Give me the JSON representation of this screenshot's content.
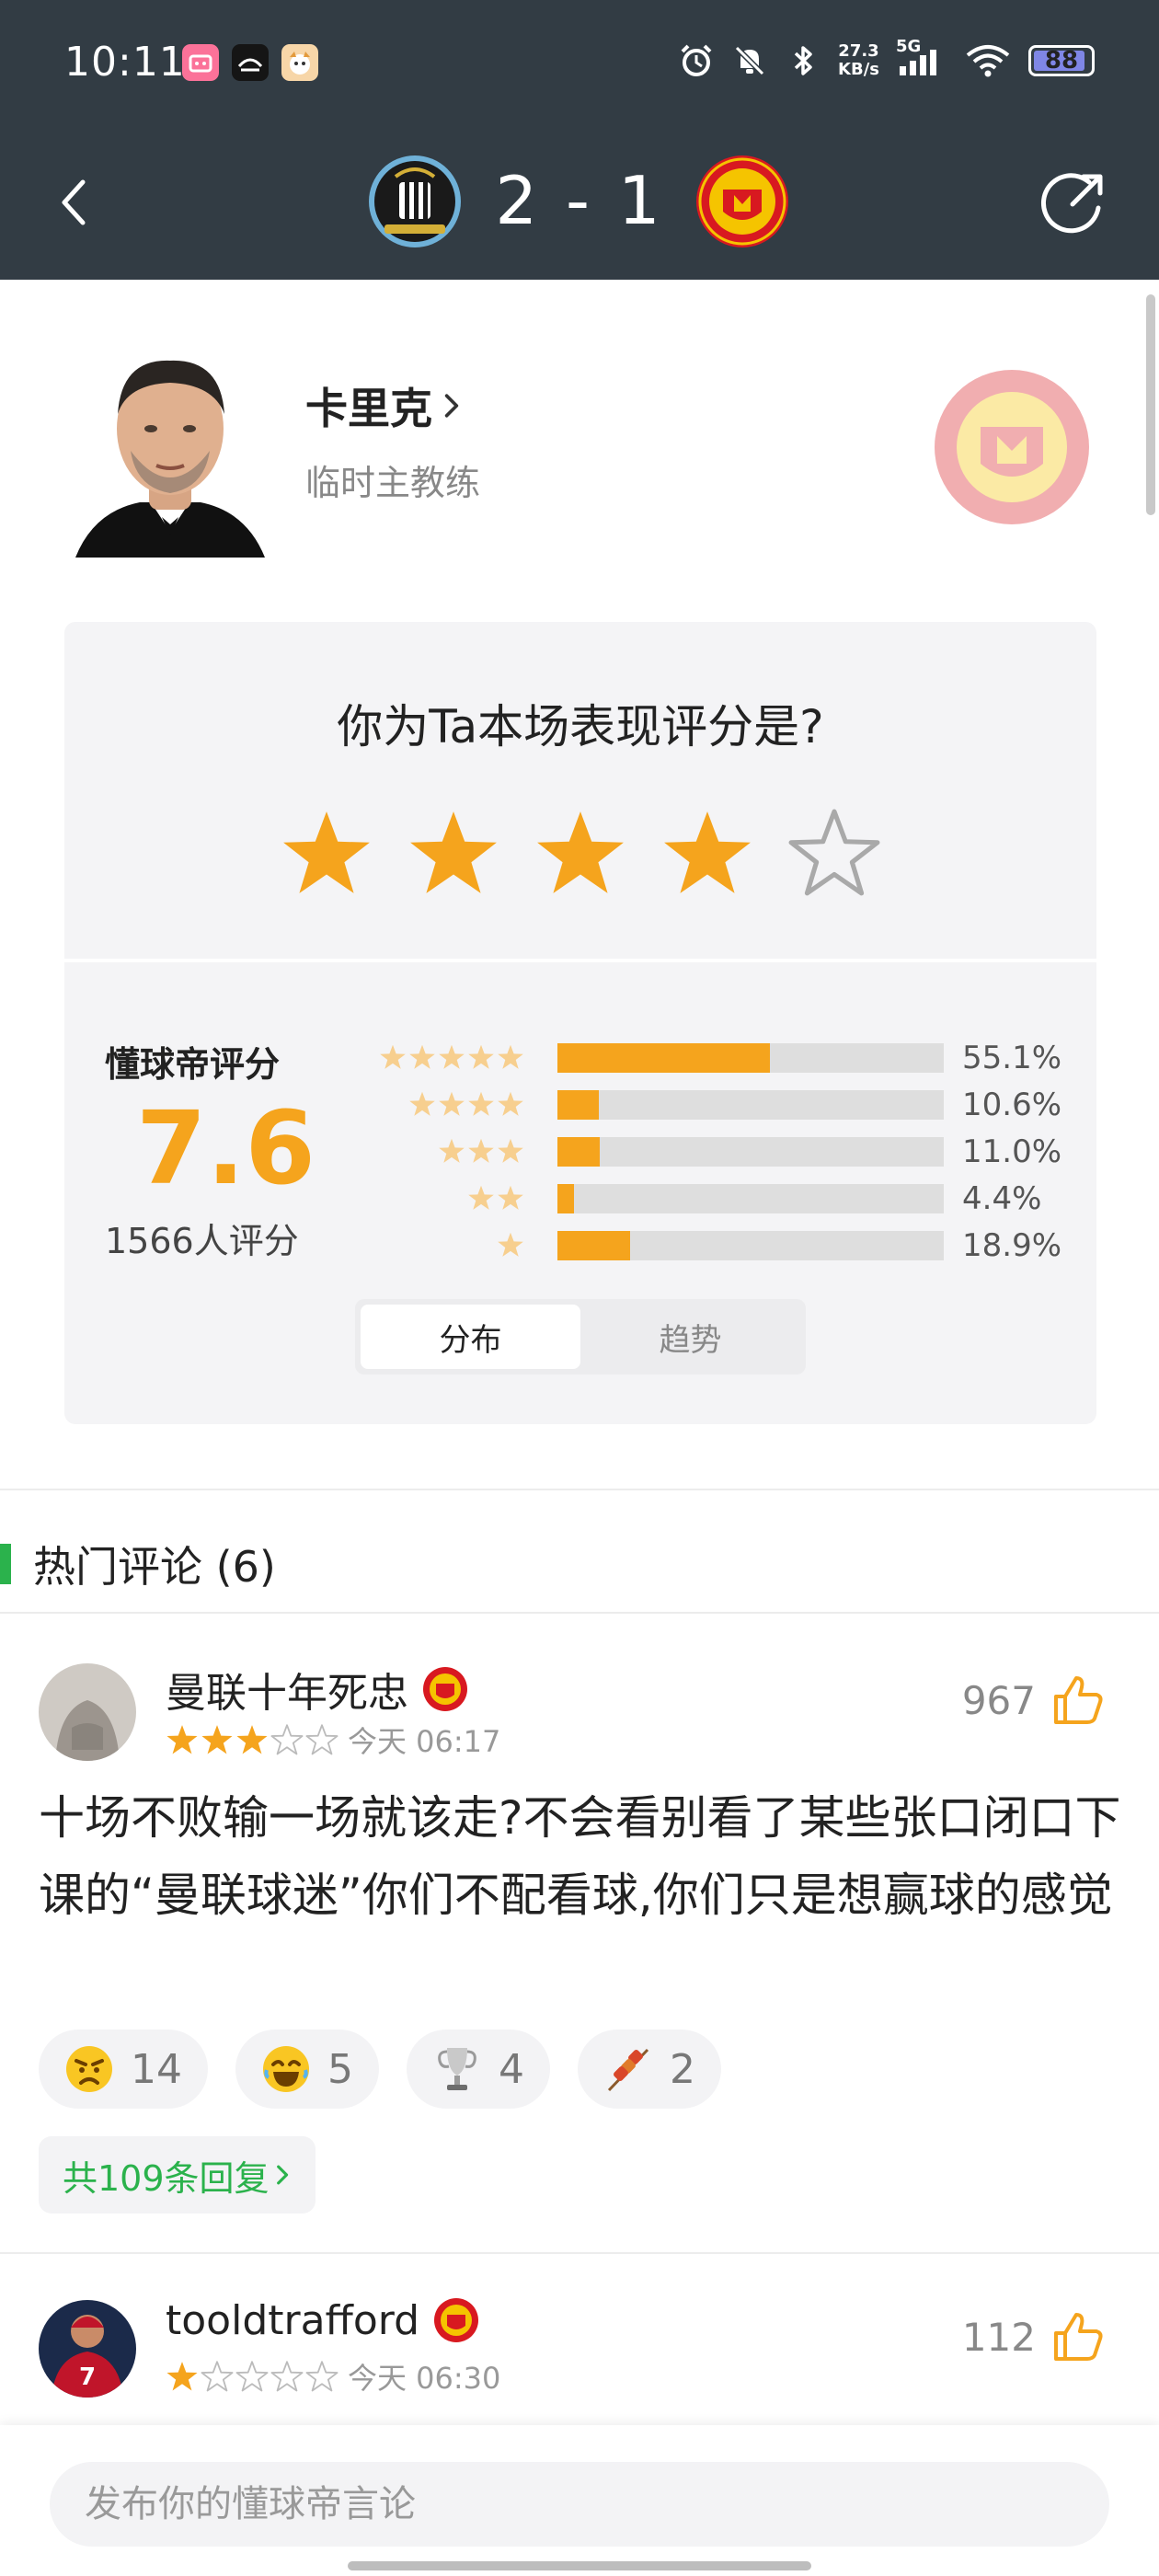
{
  "status_bar": {
    "time": "10:11",
    "network_speed_value": "27.3",
    "network_speed_unit": "KB/s",
    "signal_label": "5G",
    "battery": "88"
  },
  "match": {
    "score": "2 - 1",
    "home_team_icon": "newcastle-crest",
    "away_team_icon": "manchester-united-crest"
  },
  "coach": {
    "name": "卡里克",
    "role": "临时主教练"
  },
  "rating": {
    "question": "你为Ta本场表现评分是?",
    "user_stars": 4,
    "max_stars": 5,
    "score_label": "懂球帝评分",
    "score_value": "7.6",
    "rating_count": "1566人评分",
    "distribution": [
      {
        "stars": 5,
        "percent": 55.1,
        "label": "55.1%"
      },
      {
        "stars": 4,
        "percent": 10.6,
        "label": "10.6%"
      },
      {
        "stars": 3,
        "percent": 11.0,
        "label": "11.0%"
      },
      {
        "stars": 2,
        "percent": 4.4,
        "label": "4.4%"
      },
      {
        "stars": 1,
        "percent": 18.9,
        "label": "18.9%"
      }
    ],
    "tabs": [
      "分布",
      "趋势"
    ],
    "active_tab": 0
  },
  "comments_section": {
    "title": "热门评论 (6)"
  },
  "comments": [
    {
      "username": "曼联十年死忠",
      "stars": 3,
      "time": "今天 06:17",
      "likes": "967",
      "text": "十场不败输一场就该走?不会看别看了某些张口闭口下课的“曼联球迷”你们不配看球,你们只是想赢球的感觉",
      "reactions": [
        {
          "icon": "angry-face-icon",
          "count": "14"
        },
        {
          "icon": "laughing-face-icon",
          "count": "5"
        },
        {
          "icon": "trophy-icon",
          "count": "4"
        },
        {
          "icon": "skewer-icon",
          "count": "2"
        }
      ],
      "replies": "共109条回复"
    },
    {
      "username": "tooldtrafford",
      "stars": 1,
      "time": "今天 06:30",
      "likes": "112"
    }
  ],
  "composer": {
    "placeholder": "发布你的懂球帝言论"
  },
  "colors": {
    "header_bg": "#323c44",
    "accent_orange": "#f5a41d",
    "accent_green": "#2bb24c",
    "card_bg": "#f4f4f6"
  }
}
